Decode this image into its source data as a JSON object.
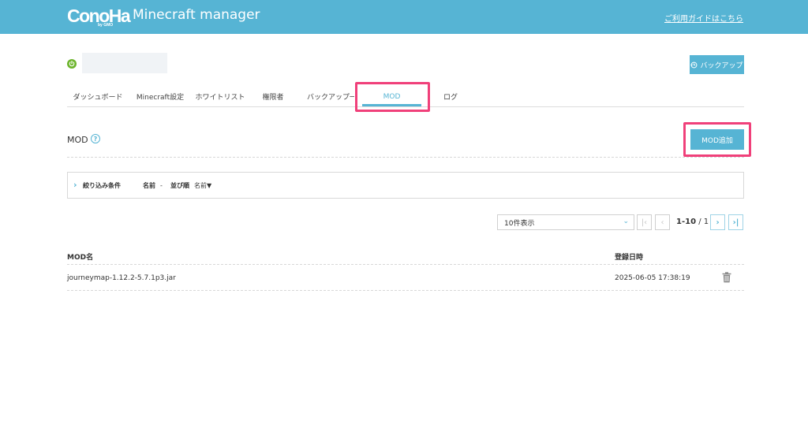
{
  "header": {
    "logo_text": "ConoHa",
    "logo_sub": "by GMO",
    "app_title": "Minecraft manager",
    "guide_link": "ご利用ガイドはこちら"
  },
  "server": {
    "status_icon": "power-icon",
    "status_color": "#6cb42c",
    "backup_button": "バックアップ"
  },
  "tabs": [
    {
      "label": "ダッシュボード",
      "active": false
    },
    {
      "label": "Minecraft設定",
      "active": false
    },
    {
      "label": "ホワイトリスト",
      "active": false
    },
    {
      "label": "権限者",
      "active": false
    },
    {
      "label": "バックアップ一覧",
      "active": false
    },
    {
      "label": "MOD",
      "active": true
    },
    {
      "label": "ログ",
      "active": false
    }
  ],
  "section": {
    "title": "MOD",
    "help_icon": "question-circle-icon",
    "add_button": "MOD追加"
  },
  "filter": {
    "label": "絞り込み条件",
    "name_key": "名前",
    "name_value": "-",
    "sort_key": "並び順",
    "sort_value": "名前▼"
  },
  "pagination": {
    "per_page": "10件表示",
    "range": "1-10",
    "separator": " / ",
    "total_pages": "1",
    "first": "|‹",
    "prev": "‹",
    "next": "›",
    "last": "›|"
  },
  "table": {
    "columns": [
      "MOD名",
      "登録日時"
    ],
    "rows": [
      {
        "name": "journeymap-1.12.2-5.7.1p3.jar",
        "date": "2025-06-05 17:38:19",
        "action_icon": "trash-icon"
      }
    ]
  },
  "colors": {
    "accent": "#56b4d4",
    "highlight": "#f0407a",
    "status_on": "#6cb42c"
  }
}
